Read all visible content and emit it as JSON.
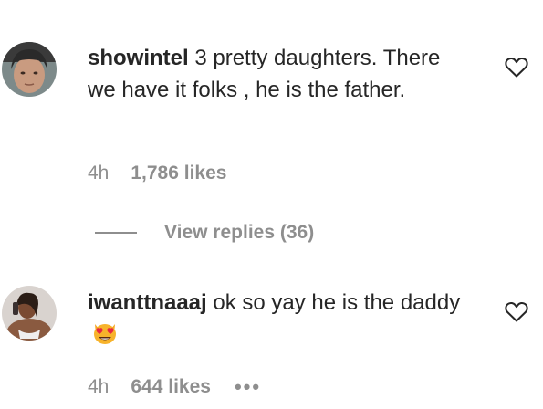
{
  "comments": [
    {
      "username": "showintel",
      "text": " 3 pretty daughters. There we have it folks , he is the father.",
      "time": "4h",
      "likes": "1,786 likes",
      "view_replies": "View replies (36)",
      "avatar_icon": "avatar-photo",
      "like_icon": "heart-outline-icon"
    },
    {
      "username": "iwanttnaaaj",
      "text": " ok so yay he is the daddy",
      "emoji": "heart-eyes-cat-emoji",
      "time": "4h",
      "likes": "644 likes",
      "more": "•••",
      "avatar_icon": "avatar-photo",
      "like_icon": "heart-outline-icon"
    }
  ],
  "colors": {
    "text": "#262626",
    "secondary": "#8e8e8e",
    "background": "#ffffff"
  }
}
